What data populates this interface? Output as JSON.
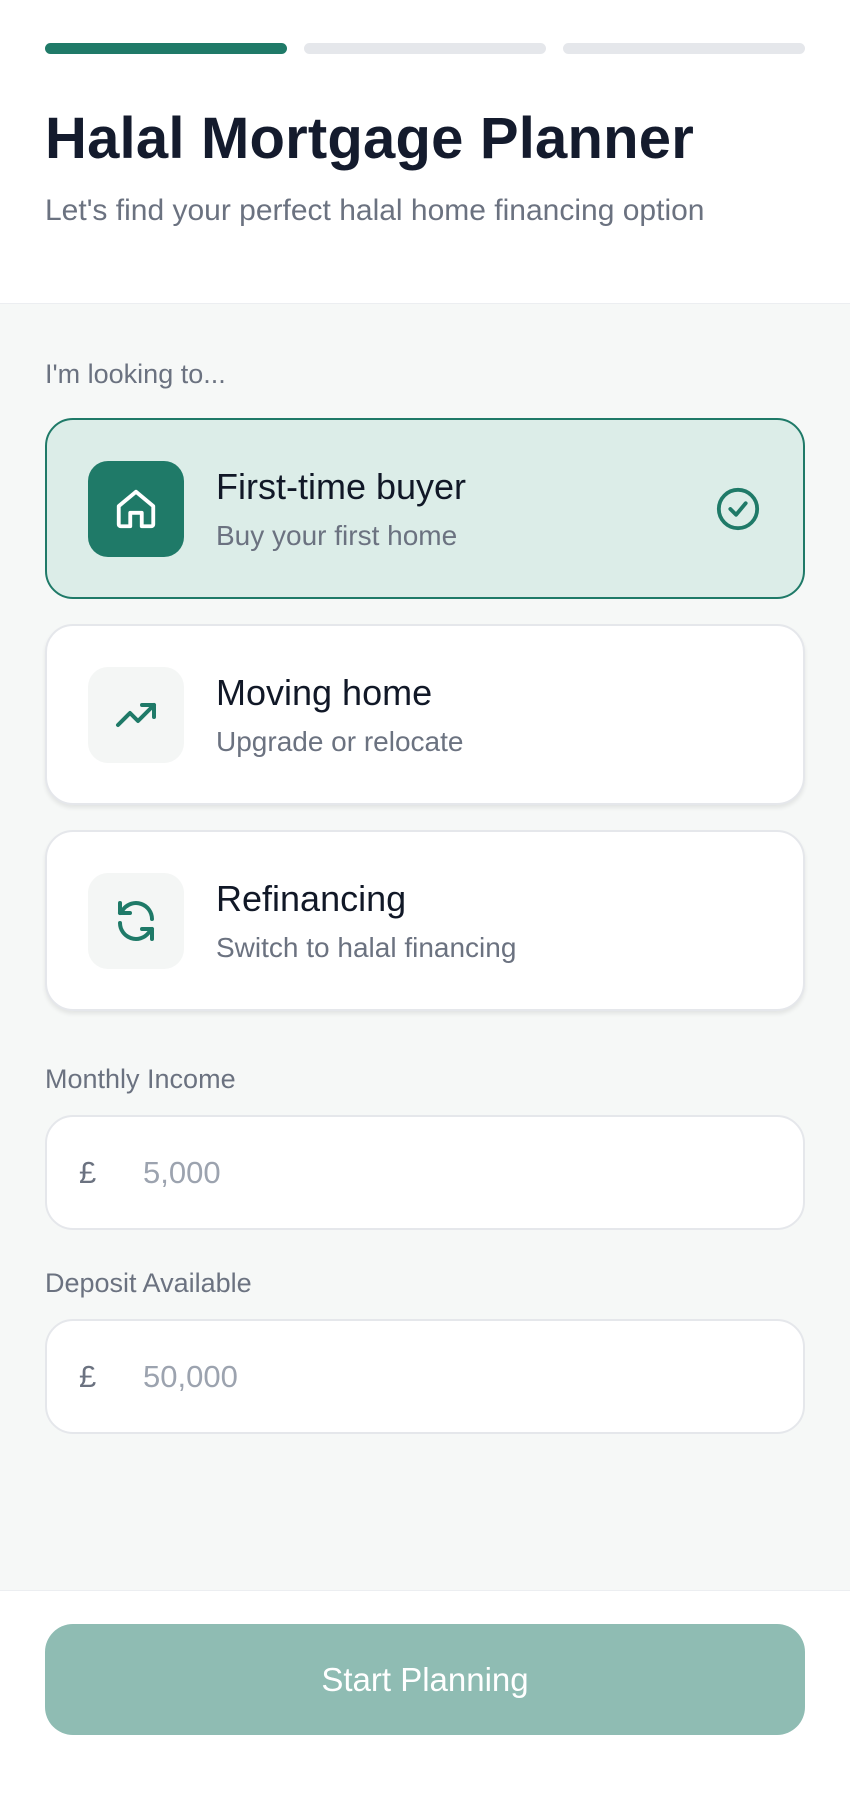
{
  "header": {
    "progress_steps": [
      {
        "active": true
      },
      {
        "active": false
      },
      {
        "active": false
      }
    ],
    "title": "Halal Mortgage Planner",
    "subtitle": "Let's find your perfect halal home financing option"
  },
  "intent": {
    "label": "I'm looking to...",
    "options": [
      {
        "title": "First-time buyer",
        "description": "Buy your first home",
        "icon": "home-icon",
        "selected": true
      },
      {
        "title": "Moving home",
        "description": "Upgrade or relocate",
        "icon": "trending-up-icon",
        "selected": false
      },
      {
        "title": "Refinancing",
        "description": "Switch to halal financing",
        "icon": "refresh-icon",
        "selected": false
      }
    ]
  },
  "income": {
    "label": "Monthly Income",
    "currency": "£",
    "placeholder": "5,000",
    "value": ""
  },
  "deposit": {
    "label": "Deposit Available",
    "currency": "£",
    "placeholder": "50,000",
    "value": ""
  },
  "footer": {
    "cta_label": "Start Planning"
  },
  "colors": {
    "accent": "#1f7a68",
    "selected_bg": "#dcede8",
    "cta_disabled": "#8fbcb3"
  }
}
